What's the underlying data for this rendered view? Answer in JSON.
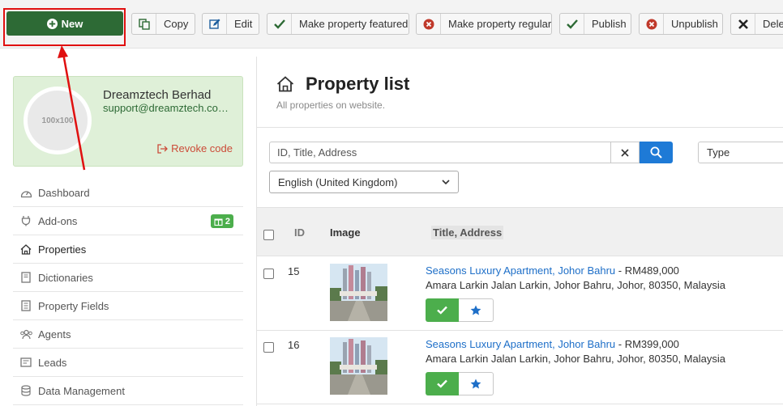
{
  "toolbar": {
    "new_label": "New",
    "copy_label": "Copy",
    "edit_label": "Edit",
    "featured_label": "Make property featured",
    "regular_label": "Make property regular",
    "publish_label": "Publish",
    "unpublish_label": "Unpublish",
    "delete_label": "Delete"
  },
  "profile": {
    "avatar_text": "100x100",
    "name": "Dreamztech Berhad",
    "email": "support@dreamztech.com.my",
    "revoke_label": "Revoke code"
  },
  "sidebar": {
    "items": [
      {
        "label": "Dashboard",
        "icon": "dashboard-icon"
      },
      {
        "label": "Add-ons",
        "icon": "plug-icon",
        "badge": "2"
      },
      {
        "label": "Properties",
        "icon": "home-icon"
      },
      {
        "label": "Dictionaries",
        "icon": "book-icon"
      },
      {
        "label": "Property Fields",
        "icon": "list-icon"
      },
      {
        "label": "Agents",
        "icon": "users-icon"
      },
      {
        "label": "Leads",
        "icon": "mail-icon"
      },
      {
        "label": "Data Management",
        "icon": "database-icon"
      }
    ]
  },
  "main": {
    "title": "Property list",
    "subtitle": "All properties on website.",
    "search_placeholder": "ID, Title, Address",
    "type_placeholder": "Type",
    "language": "English (United Kingdom)",
    "columns": {
      "id": "ID",
      "image": "Image",
      "title": "Title, Address"
    }
  },
  "rows": [
    {
      "id": "15",
      "title": "Seasons Luxury Apartment, Johor Bahru",
      "price": " - RM489,000",
      "address": "Amara Larkin Jalan Larkin, Johor Bahru, Johor, 80350, Malaysia"
    },
    {
      "id": "16",
      "title": "Seasons Luxury Apartment, Johor Bahru",
      "price": " - RM399,000",
      "address": "Amara Larkin Jalan Larkin, Johor Bahru, Johor, 80350, Malaysia"
    }
  ],
  "colors": {
    "new_button": "#2d6a35",
    "highlight": "#e01010",
    "link": "#1e6fc8",
    "publish": "#4cae4c",
    "search_button": "#1e7ad6",
    "profile_bg": "#dff0d8"
  }
}
